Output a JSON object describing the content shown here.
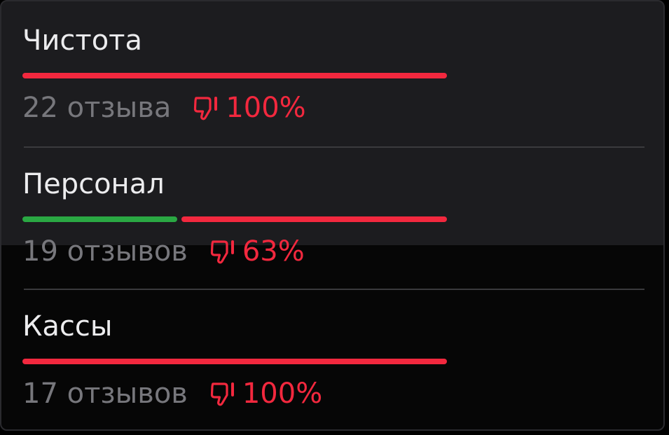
{
  "colors": {
    "negative": "#f2283e",
    "positive": "#2aa843",
    "title_text": "#ececee",
    "muted_text": "#77777c"
  },
  "ratings": [
    {
      "title": "Чистота",
      "reviews": "22 отзыва",
      "percent_label": "100%",
      "positive_fraction": 0,
      "negative_fraction": 1.0,
      "sentiment_icon": "thumbs-down-icon"
    },
    {
      "title": "Персонал",
      "reviews": "19 отзывов",
      "percent_label": "63%",
      "positive_fraction": 0.37,
      "negative_fraction": 0.63,
      "sentiment_icon": "thumbs-down-icon"
    },
    {
      "title": "Кассы",
      "reviews": "17 отзывов",
      "percent_label": "100%",
      "positive_fraction": 0,
      "negative_fraction": 1.0,
      "sentiment_icon": "thumbs-down-icon"
    }
  ]
}
